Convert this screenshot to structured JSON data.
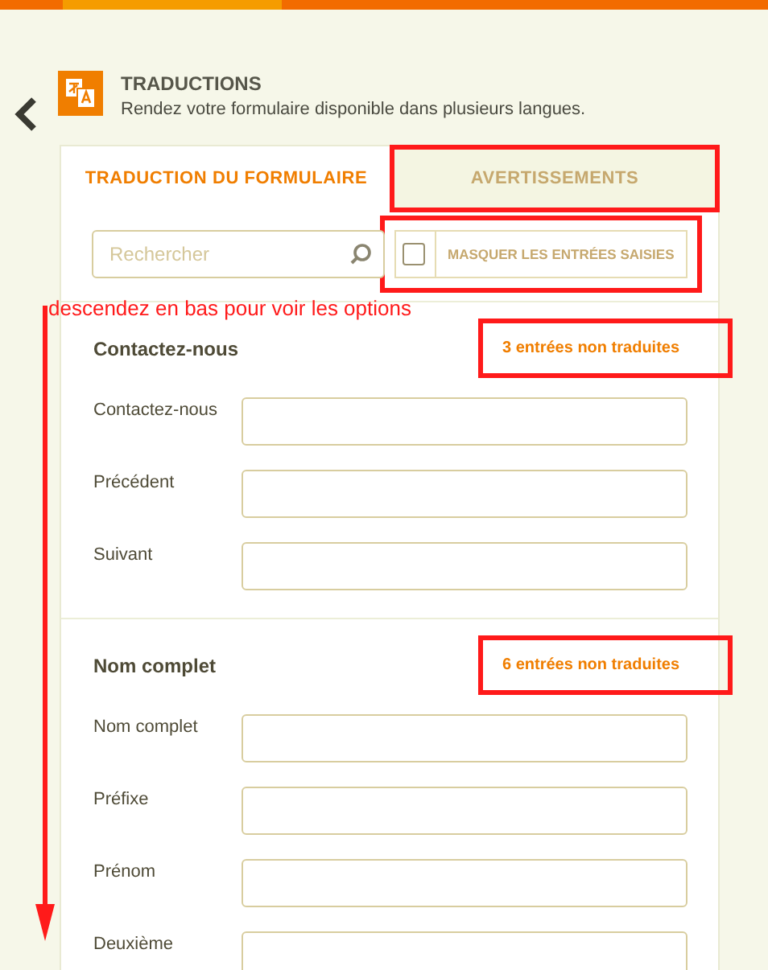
{
  "header": {
    "title": "TRADUCTIONS",
    "subtitle": "Rendez votre formulaire disponible dans plusieurs langues."
  },
  "tabs": [
    {
      "label": "TRADUCTION DU FORMULAIRE",
      "selected": true,
      "highlighted": false
    },
    {
      "label": "AVERTISSEMENTS",
      "selected": false,
      "highlighted": true
    }
  ],
  "search": {
    "placeholder": "Rechercher"
  },
  "hide_filled": {
    "label": "MASQUER LES ENTRÉES SAISIES",
    "checked": false,
    "highlighted": true
  },
  "annotation": "descendez en bas pour voir les options",
  "sections": [
    {
      "title": "Contactez-nous",
      "count": "3 entrées non traduites",
      "highlighted": true,
      "fields": [
        {
          "label": "Contactez-nous"
        },
        {
          "label": "Précédent"
        },
        {
          "label": "Suivant"
        }
      ]
    },
    {
      "title": "Nom complet",
      "count": "6 entrées non traduites",
      "highlighted": true,
      "fields": [
        {
          "label": "Nom complet"
        },
        {
          "label": "Préfixe"
        },
        {
          "label": "Prénom"
        },
        {
          "label": "Deuxième"
        }
      ]
    }
  ]
}
